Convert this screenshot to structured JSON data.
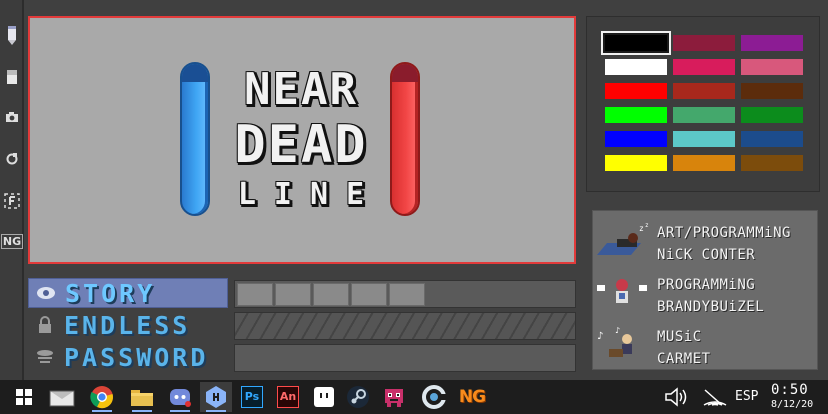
{
  "toolbar": {
    "tools": [
      "pencil-icon",
      "eraser-icon",
      "camera-icon",
      "reset-icon",
      "f-frame-icon",
      "ng-logo-icon"
    ],
    "ng_label": "NG"
  },
  "title_screen": {
    "logo": {
      "line1": "NEAR",
      "line2": "DEAD",
      "line3": "LINE"
    }
  },
  "menu": {
    "items": [
      {
        "label": "STORY",
        "icon": "eye-icon",
        "active": true
      },
      {
        "label": "ENDLESS",
        "icon": "lock-icon",
        "active": false
      },
      {
        "label": "PASSWORD",
        "icon": "stack-icon",
        "active": false
      }
    ],
    "story_progress_slots_filled": 5
  },
  "palette": {
    "colors": [
      "#000000",
      "#8c1c3c",
      "#8c1c94",
      "#ffffff",
      "#d81c5c",
      "#d8587c",
      "#ff0000",
      "#a8281c",
      "#5c2c0c",
      "#00ff00",
      "#44a86c",
      "#0c8c1c",
      "#0000ff",
      "#5cc8c8",
      "#1c4c8c",
      "#ffff00",
      "#d8840c",
      "#7c4c0c"
    ],
    "selected_index": 0
  },
  "credits": [
    {
      "role": "ART/PROGRAMMiNG",
      "name": "NiCK CONTER",
      "avatar": "sleeping-artist-icon"
    },
    {
      "role": "PROGRAMMiNG",
      "name": "BRANDYBUiZEL",
      "avatar": "programmer-icon"
    },
    {
      "role": "MUSiC",
      "name": "CARMET",
      "avatar": "musician-icon"
    }
  ],
  "taskbar": {
    "apps": [
      "windows-start-icon",
      "mail-icon",
      "chrome-icon",
      "file-explorer-icon",
      "discord-icon",
      "hexcode-app-icon",
      "photoshop-icon",
      "animate-icon",
      "gamepad-app-icon",
      "steam-icon",
      "pixel-creature-icon",
      "cclean-icon",
      "newgrounds-icon"
    ],
    "ps_label": "Ps",
    "an_label": "An",
    "ng_label": "NG",
    "language": "ESP",
    "time": "0:50",
    "date": "8/12/20"
  }
}
